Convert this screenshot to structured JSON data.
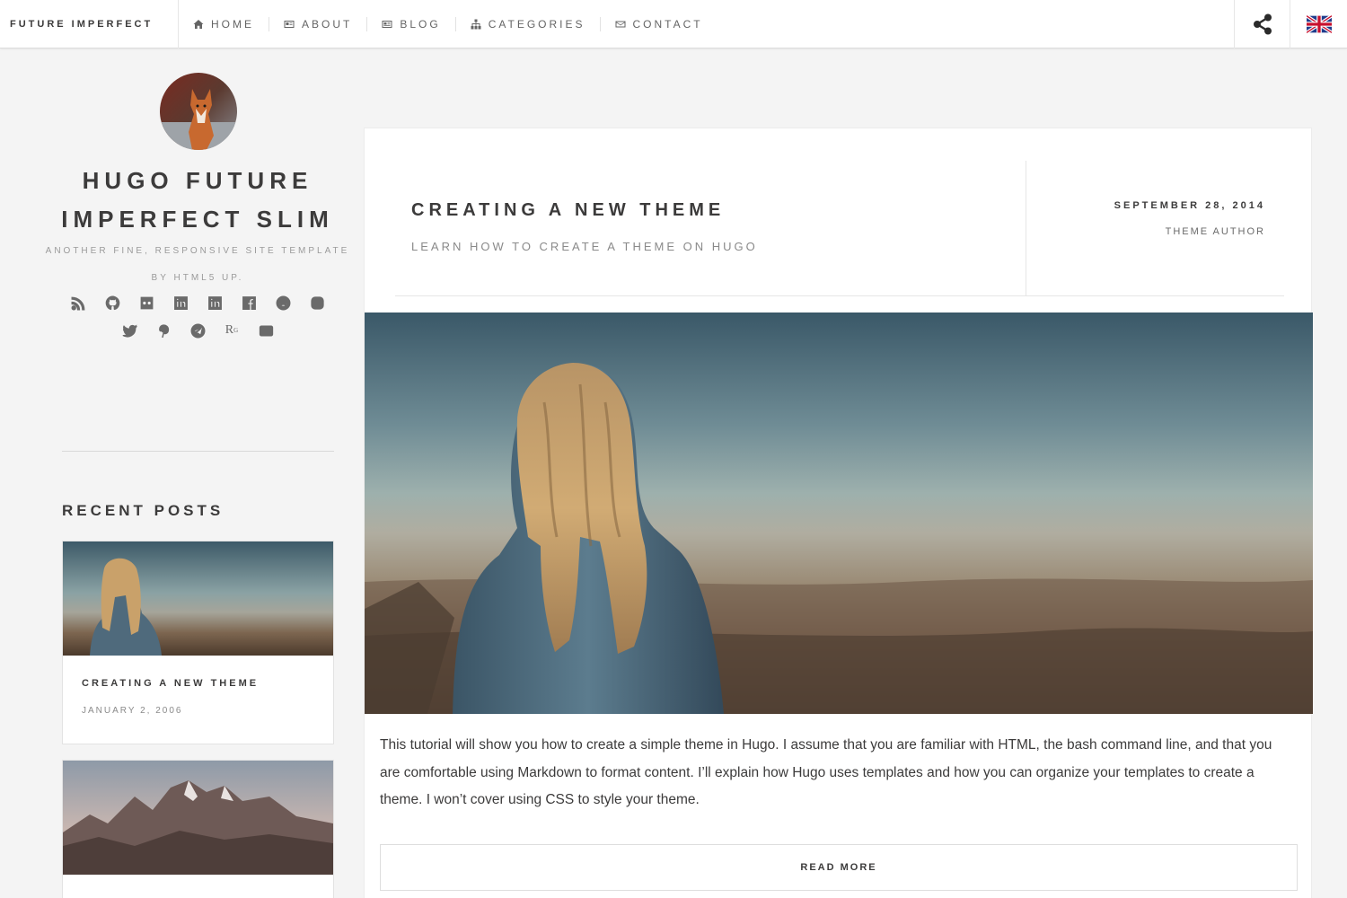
{
  "header": {
    "brand": "FUTURE IMPERFECT",
    "nav": [
      {
        "label": "HOME",
        "icon": "home-icon"
      },
      {
        "label": "ABOUT",
        "icon": "id-card-icon"
      },
      {
        "label": "BLOG",
        "icon": "newspaper-icon"
      },
      {
        "label": "CATEGORIES",
        "icon": "sitemap-icon"
      },
      {
        "label": "CONTACT",
        "icon": "envelope-icon"
      }
    ],
    "share_icon": "share-icon",
    "language_icon": "uk-flag-icon"
  },
  "sidebar": {
    "title": "HUGO FUTURE IMPERFECT SLIM",
    "tagline": "ANOTHER FINE, RESPONSIVE SITE TEMPLATE BY HTML5 UP.",
    "social_icons_row1": [
      "rss-icon",
      "github-icon",
      "flickr-icon",
      "linkedin-icon",
      "linkedin-icon",
      "facebook-icon",
      "reddit-icon",
      "instagram-icon"
    ],
    "social_icons_row2": [
      "twitter-icon",
      "pinterest-icon",
      "telegram-icon",
      "researchgate-icon",
      "envelope-icon"
    ],
    "researchgate_glyph": "R",
    "researchgate_sup": "G",
    "recent_heading": "RECENT POSTS",
    "recent_posts": [
      {
        "title": "CREATING A NEW THEME",
        "date": "JANUARY 2, 2006"
      },
      {
        "title": "",
        "date": ""
      }
    ]
  },
  "post": {
    "title": "CREATING A NEW THEME",
    "subtitle": "LEARN HOW TO CREATE A THEME ON HUGO",
    "date": "SEPTEMBER 28, 2014",
    "author": "THEME AUTHOR",
    "excerpt": "This tutorial will show you how to create a simple theme in Hugo. I assume that you are familiar with HTML, the bash command line, and that you are comfortable using Markdown to format content. I’ll explain how Hugo uses templates and how you can organize your templates to create a theme. I won’t cover using CSS to style your theme.",
    "read_more": "READ MORE"
  },
  "colors": {
    "background": "#f4f4f4",
    "text": "#3c3b3b",
    "muted": "#8a8a8a"
  }
}
